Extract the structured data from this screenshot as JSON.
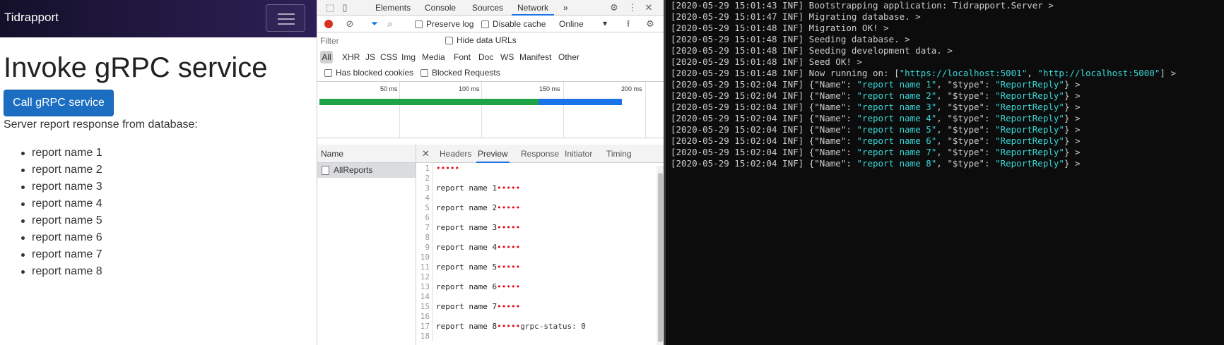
{
  "page": {
    "brand": "Tidrapport",
    "heading": "Invoke gRPC service",
    "button_label": "Call gRPC service",
    "response_text": "Server report response from database:",
    "reports": [
      "report name 1",
      "report name 2",
      "report name 3",
      "report name 4",
      "report name 5",
      "report name 6",
      "report name 7",
      "report name 8"
    ]
  },
  "devtools": {
    "tabs": {
      "elements": "Elements",
      "console": "Console",
      "sources": "Sources",
      "network": "Network",
      "more": "»"
    },
    "toolbar": {
      "preserve_log": "Preserve log",
      "disable_cache": "Disable cache",
      "throttle": "Online"
    },
    "filter_placeholder": "Filter",
    "hide_data_urls": "Hide data URLs",
    "types": [
      "All",
      "XHR",
      "JS",
      "CSS",
      "Img",
      "Media",
      "Font",
      "Doc",
      "WS",
      "Manifest",
      "Other"
    ],
    "has_blocked_cookies": "Has blocked cookies",
    "blocked_requests": "Blocked Requests",
    "timeline_labels": [
      "50 ms",
      "100 ms",
      "150 ms",
      "200 ms"
    ],
    "name_header": "Name",
    "request_name": "AllReports",
    "detail_tabs": [
      "Headers",
      "Preview",
      "Response",
      "Initiator",
      "Timing"
    ],
    "preview_lines": [
      {
        "n": "1",
        "t": "",
        "d": "•••••",
        "s": ""
      },
      {
        "n": "2",
        "t": "",
        "d": "",
        "s": ""
      },
      {
        "n": "3",
        "t": "report name 1",
        "d": "•••••",
        "s": ""
      },
      {
        "n": "4",
        "t": "",
        "d": "",
        "s": ""
      },
      {
        "n": "5",
        "t": "report name 2",
        "d": "•••••",
        "s": ""
      },
      {
        "n": "6",
        "t": "",
        "d": "",
        "s": ""
      },
      {
        "n": "7",
        "t": "report name 3",
        "d": "•••••",
        "s": ""
      },
      {
        "n": "8",
        "t": "",
        "d": "",
        "s": ""
      },
      {
        "n": "9",
        "t": "report name 4",
        "d": "•••••",
        "s": ""
      },
      {
        "n": "10",
        "t": "",
        "d": "",
        "s": ""
      },
      {
        "n": "11",
        "t": "report name 5",
        "d": "•••••",
        "s": ""
      },
      {
        "n": "12",
        "t": "",
        "d": "",
        "s": ""
      },
      {
        "n": "13",
        "t": "report name 6",
        "d": "•••••",
        "s": ""
      },
      {
        "n": "14",
        "t": "",
        "d": "",
        "s": ""
      },
      {
        "n": "15",
        "t": "report name 7",
        "d": "•••••",
        "s": ""
      },
      {
        "n": "16",
        "t": "",
        "d": "",
        "s": ""
      },
      {
        "n": "17",
        "t": "report name 8",
        "d": "•••••",
        "s": "grpc-status: 0"
      },
      {
        "n": "18",
        "t": "",
        "d": "",
        "s": ""
      }
    ]
  },
  "console_lines": [
    {
      "p": "[2020-05-29 15:01:43 INF] ",
      "t": "Bootstrapping application: Tidrapport.Server >"
    },
    {
      "p": "[2020-05-29 15:01:47 INF] ",
      "t": "Migrating database. >"
    },
    {
      "p": "[2020-05-29 15:01:48 INF] ",
      "t": "Migration OK! >"
    },
    {
      "p": "[2020-05-29 15:01:48 INF] ",
      "t": "Seeding database. >"
    },
    {
      "p": "[2020-05-29 15:01:48 INF] ",
      "t": "Seeding development data. >"
    },
    {
      "p": "[2020-05-29 15:01:48 INF] ",
      "t": "Seed OK! >"
    },
    {
      "p": "[2020-05-29 15:01:48 INF] ",
      "t": "Now running on: [",
      "c1": "\"https://localhost:5001\"",
      "m": ", ",
      "c2": "\"http://localhost:5000\"",
      "e": "] >"
    },
    {
      "p": "[2020-05-29 15:02:04 INF] ",
      "t": "{\"Name\": ",
      "c1": "\"report name 1\"",
      "m": ", \"$type\": ",
      "c2": "\"ReportReply\"",
      "e": "} >"
    },
    {
      "p": "[2020-05-29 15:02:04 INF] ",
      "t": "{\"Name\": ",
      "c1": "\"report name 2\"",
      "m": ", \"$type\": ",
      "c2": "\"ReportReply\"",
      "e": "} >"
    },
    {
      "p": "[2020-05-29 15:02:04 INF] ",
      "t": "{\"Name\": ",
      "c1": "\"report name 3\"",
      "m": ", \"$type\": ",
      "c2": "\"ReportReply\"",
      "e": "} >"
    },
    {
      "p": "[2020-05-29 15:02:04 INF] ",
      "t": "{\"Name\": ",
      "c1": "\"report name 4\"",
      "m": ", \"$type\": ",
      "c2": "\"ReportReply\"",
      "e": "} >"
    },
    {
      "p": "[2020-05-29 15:02:04 INF] ",
      "t": "{\"Name\": ",
      "c1": "\"report name 5\"",
      "m": ", \"$type\": ",
      "c2": "\"ReportReply\"",
      "e": "} >"
    },
    {
      "p": "[2020-05-29 15:02:04 INF] ",
      "t": "{\"Name\": ",
      "c1": "\"report name 6\"",
      "m": ", \"$type\": ",
      "c2": "\"ReportReply\"",
      "e": "} >"
    },
    {
      "p": "[2020-05-29 15:02:04 INF] ",
      "t": "{\"Name\": ",
      "c1": "\"report name 7\"",
      "m": ", \"$type\": ",
      "c2": "\"ReportReply\"",
      "e": "} >"
    },
    {
      "p": "[2020-05-29 15:02:04 INF] ",
      "t": "{\"Name\": ",
      "c1": "\"report name 8\"",
      "m": ", \"$type\": ",
      "c2": "\"ReportReply\"",
      "e": "} >"
    }
  ]
}
